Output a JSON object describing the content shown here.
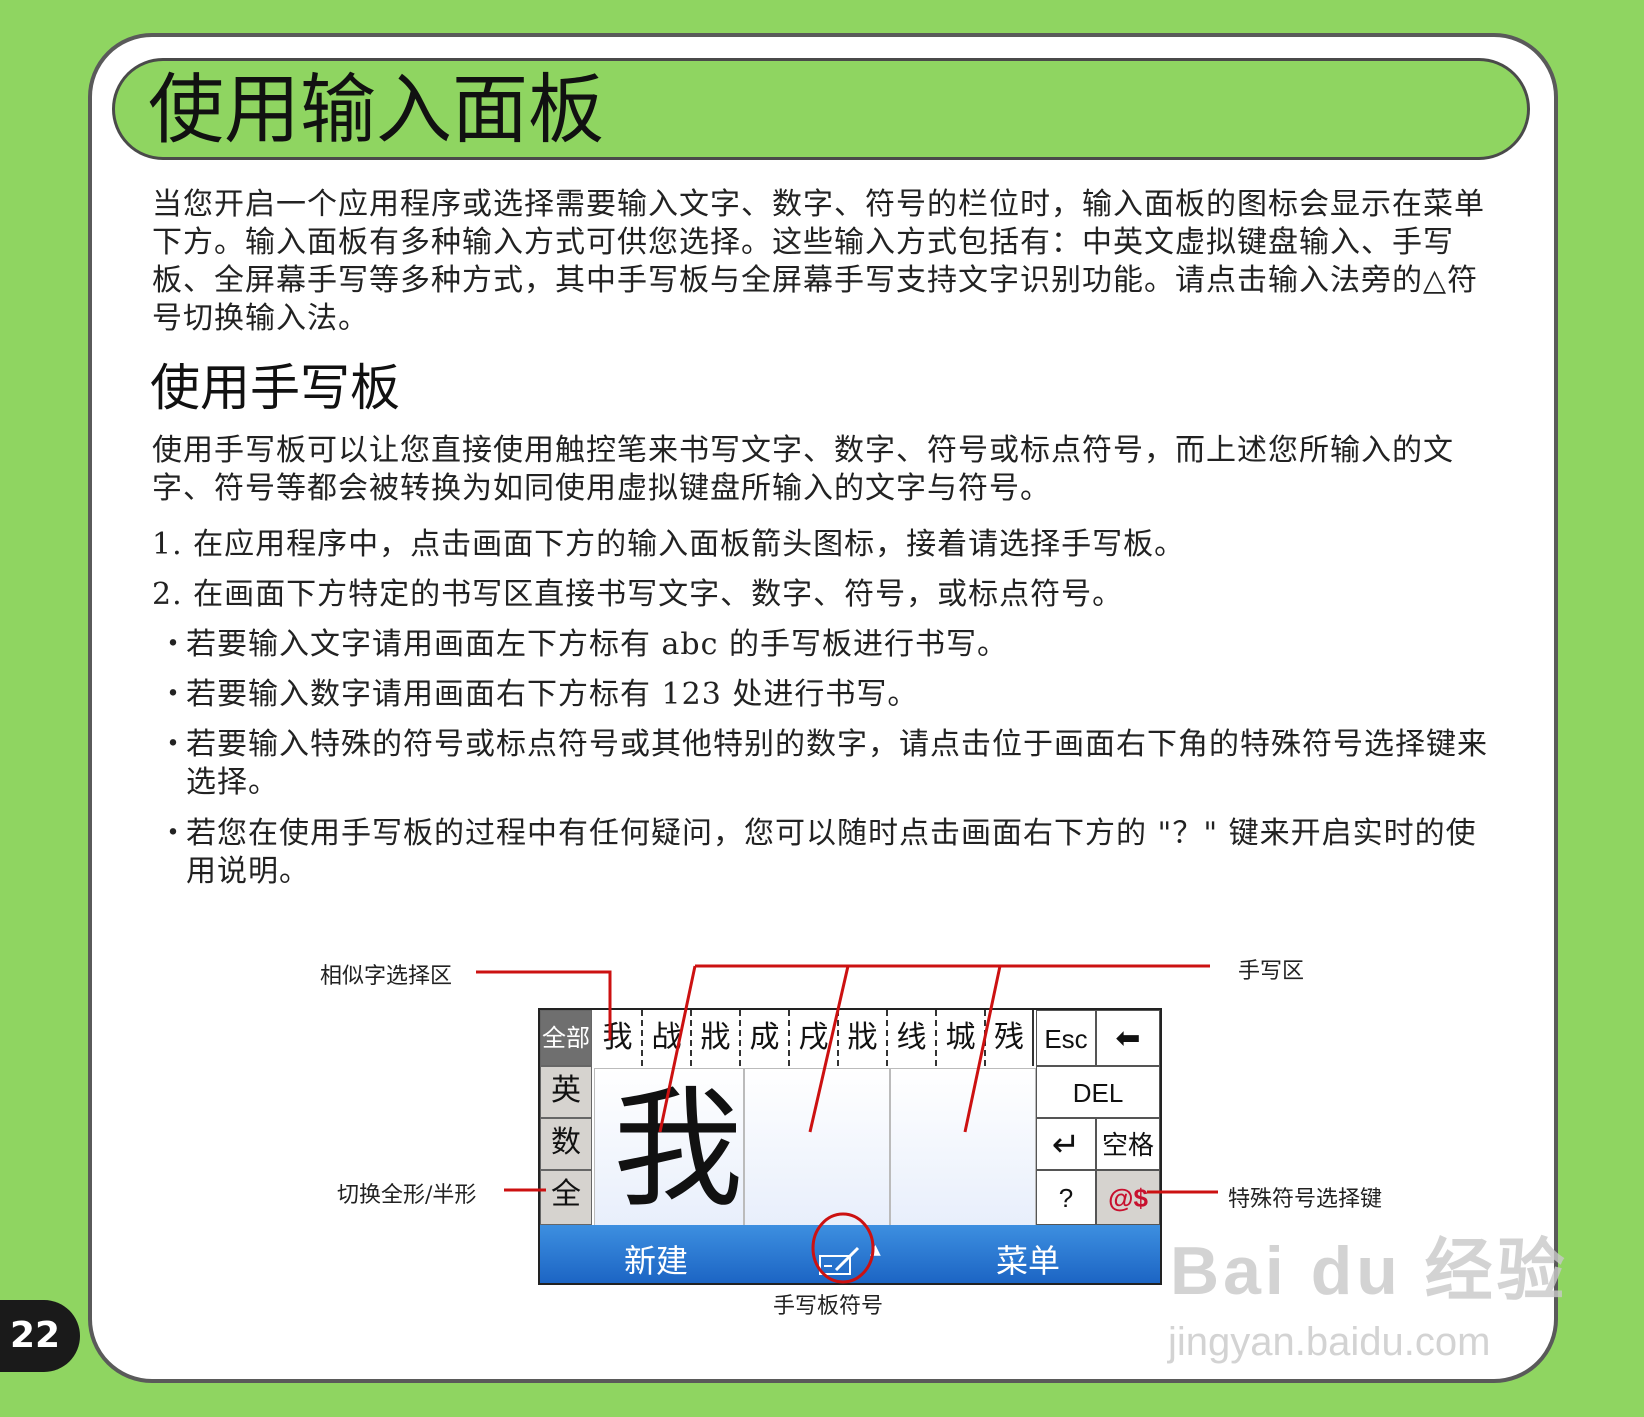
{
  "title": "使用输入面板",
  "intro": "当您开启一个应用程序或选择需要输入文字、数字、符号的栏位时，输入面板的图标会显示在菜单下方。输入面板有多种输入方式可供您选择。这些输入方式包括有：中英文虚拟键盘输入、手写板、全屏幕手写等多种方式，其中手写板与全屏幕手写支持文字识别功能。请点击输入法旁的△符号切换输入法。",
  "subheading": "使用手写板",
  "para": "使用手写板可以让您直接使用触控笔来书写文字、数字、符号或标点符号，而上述您所输入的文字、符号等都会被转换为如同使用虚拟键盘所输入的文字与符号。",
  "steps": [
    "1. 在应用程序中，点击画面下方的输入面板箭头图标，接着请选择手写板。",
    "2. 在画面下方特定的书写区直接书写文字、数字、符号，或标点符号。"
  ],
  "bullets": [
    "若要输入文字请用画面左下方标有 abc 的手写板进行书写。",
    "若要输入数字请用画面右下方标有 123 处进行书写。",
    "若要输入特殊的符号或标点符号或其他特别的数字，请点击位于画面右下角的特殊符号选择键来选择。",
    "若您在使用手写板的过程中有任何疑问，您可以随时点击画面右下方的 \"？\" 键来开启实时的使用说明。"
  ],
  "bullet_mark": "・",
  "callouts": {
    "similar": "相似字选择区",
    "write_area": "手写区",
    "toggle_width": "切换全形/半形",
    "special_key": "特殊符号选择键",
    "pad_symbol": "手写板符号"
  },
  "panel": {
    "modes": [
      "全部",
      "英",
      "数",
      "全"
    ],
    "candidates": [
      "我",
      "战",
      "戕",
      "成",
      "戌",
      "戕",
      "线",
      "城",
      "残"
    ],
    "keys": {
      "esc": "Esc",
      "backspace": "⬅",
      "del": "DEL",
      "enter": "↵",
      "space": "空格",
      "help": "?",
      "special": "@$"
    },
    "written_char": "我",
    "taskbar": {
      "left": "新建",
      "right": "菜单",
      "arrow": "▲"
    }
  },
  "page_number": "22",
  "watermark": {
    "logo": "Bai du 经验",
    "url": "jingyan.baidu.com"
  },
  "colors": {
    "accent_green": "#8fd561",
    "callout_red": "#cc1111",
    "taskbar_blue": "#1a62c2"
  }
}
